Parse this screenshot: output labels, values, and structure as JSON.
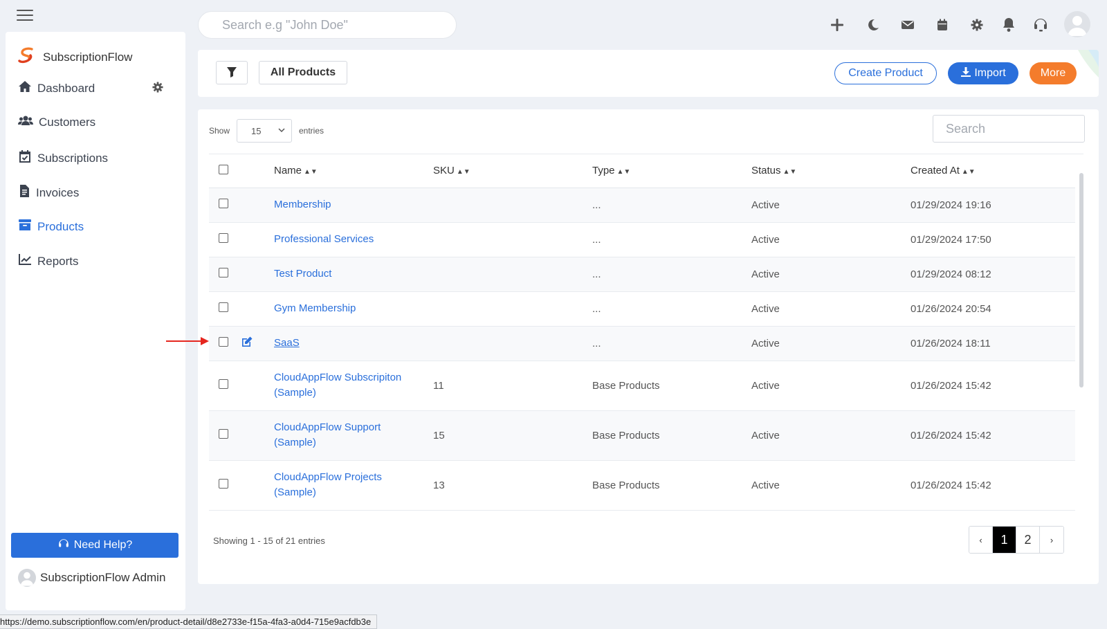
{
  "header": {
    "search_placeholder": "Search e.g \"John Doe\""
  },
  "icons": [
    "plus-icon",
    "moon-icon",
    "mail-icon",
    "calendar-icon",
    "gear-icon",
    "bell-icon",
    "headset-icon",
    "user-avatar-icon"
  ],
  "sidebar": {
    "brand": "SubscriptionFlow",
    "items": [
      {
        "label": "Dashboard",
        "icon": "home-icon"
      },
      {
        "label": "Customers",
        "icon": "users-icon"
      },
      {
        "label": "Subscriptions",
        "icon": "calendar-check-icon"
      },
      {
        "label": "Invoices",
        "icon": "invoice-icon"
      },
      {
        "label": "Products",
        "icon": "archive-icon",
        "active": true
      },
      {
        "label": "Reports",
        "icon": "chart-icon"
      }
    ],
    "help_label": "Need Help?",
    "admin_name": "SubscriptionFlow Admin"
  },
  "toolbar": {
    "view_label": "All Products",
    "create_label": "Create Product",
    "import_label": "Import",
    "more_label": "More"
  },
  "table": {
    "show_label": "Show",
    "entries_value": "15",
    "entries_label": "entries",
    "search_placeholder": "Search",
    "columns": [
      "Name",
      "SKU",
      "Type",
      "Status",
      "Created At"
    ],
    "rows": [
      {
        "name": "Membership",
        "sku": "",
        "type": "...",
        "status": "Active",
        "created": "01/29/2024 19:16"
      },
      {
        "name": "Professional Services",
        "sku": "",
        "type": "...",
        "status": "Active",
        "created": "01/29/2024 17:50"
      },
      {
        "name": "Test Product",
        "sku": "",
        "type": "...",
        "status": "Active",
        "created": "01/29/2024 08:12"
      },
      {
        "name": "Gym Membership",
        "sku": "",
        "type": "...",
        "status": "Active",
        "created": "01/26/2024 20:54"
      },
      {
        "name": "SaaS",
        "sku": "",
        "type": "...",
        "status": "Active",
        "created": "01/26/2024 18:11"
      },
      {
        "name": "CloudAppFlow Subscripiton (Sample)",
        "sku": "11",
        "type": "Base Products",
        "status": "Active",
        "created": "01/26/2024 15:42"
      },
      {
        "name": "CloudAppFlow Support (Sample)",
        "sku": "15",
        "type": "Base Products",
        "status": "Active",
        "created": "01/26/2024 15:42"
      },
      {
        "name": "CloudAppFlow Projects (Sample)",
        "sku": "13",
        "type": "Base Products",
        "status": "Active",
        "created": "01/26/2024 15:42"
      }
    ],
    "showing_text": "Showing 1 - 15 of 21 entries",
    "pagination": {
      "prev": "‹",
      "pages": [
        "1",
        "2"
      ],
      "next": "›",
      "current": "1"
    }
  },
  "status_bar_url": "https://demo.subscriptionflow.com/en/product-detail/d8e2733e-f15a-4fa3-a0d4-715e9acfdb3e",
  "colors": {
    "accent": "#2a6fdb",
    "more": "#f47c2c",
    "background": "#eef1f6"
  }
}
